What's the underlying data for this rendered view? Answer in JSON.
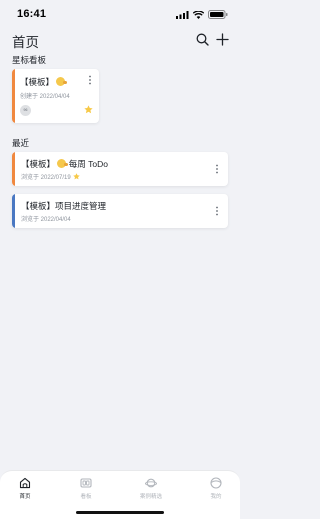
{
  "status": {
    "time": "16:41"
  },
  "header": {
    "title": "首页"
  },
  "sections": {
    "starred": "星标看板",
    "recent": "最近"
  },
  "starred_card": {
    "title": "【模板】",
    "meta": "创建于 2022/04/04",
    "avatar_text": "96",
    "accent": "#f0883e"
  },
  "recent": [
    {
      "prefix": "【模板】",
      "emoji": true,
      "title": " 每周 ToDo",
      "meta": "浏览于 2022/07/19",
      "starred": true,
      "accent": "#f0883e"
    },
    {
      "prefix": "【模板】",
      "emoji": false,
      "title": "项目进度管理",
      "meta": "浏览于 2022/04/04",
      "starred": false,
      "accent": "#4a78c2"
    }
  ],
  "tabs": [
    {
      "label": "首页",
      "icon": "home-icon",
      "active": true
    },
    {
      "label": "看板",
      "icon": "board-icon",
      "active": false
    },
    {
      "label": "案例精选",
      "icon": "planet-icon",
      "active": false
    },
    {
      "label": "我的",
      "icon": "profile-icon",
      "active": false
    }
  ],
  "colors": {
    "star": "#f7c948",
    "background": "#f1f2f6"
  }
}
